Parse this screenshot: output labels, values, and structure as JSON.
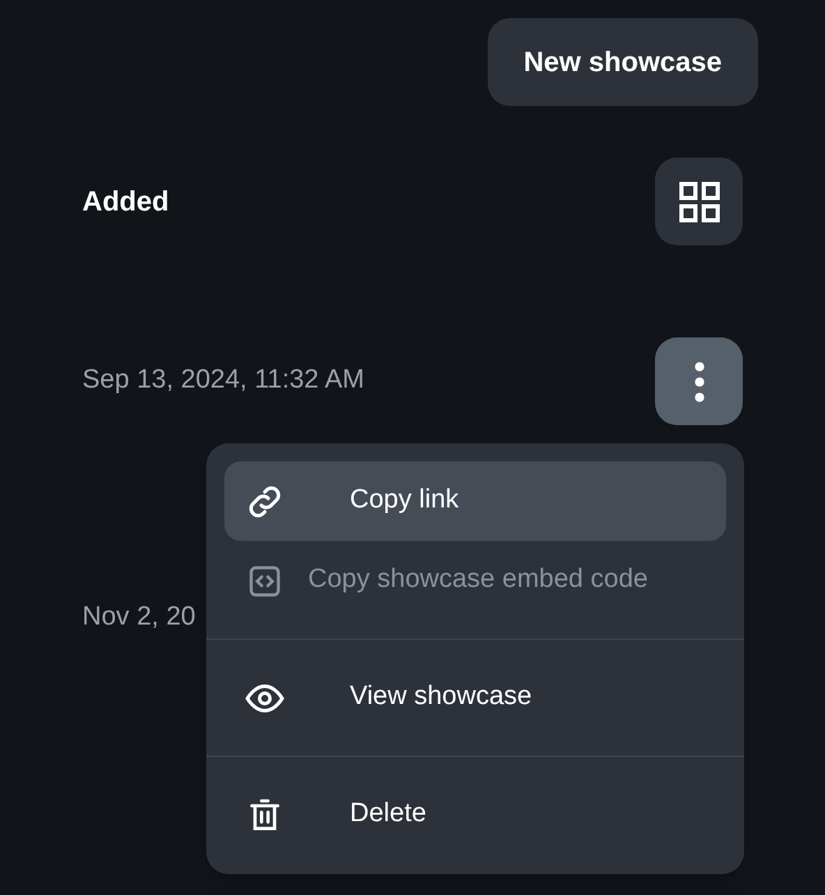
{
  "new_button": {
    "label": "New showcase"
  },
  "header": {
    "label": "Added"
  },
  "rows": [
    {
      "date": "Sep 13, 2024, 11:32 AM",
      "more_button": {
        "active": true
      }
    },
    {
      "date": "Nov 2, 20"
    }
  ],
  "menu": {
    "items": [
      {
        "kind": "link",
        "label": "Copy link",
        "selected": true,
        "disabled": false
      },
      {
        "kind": "embed",
        "label": "Copy showcase embed code",
        "selected": false,
        "disabled": true
      },
      {
        "kind": "view",
        "label": "View showcase",
        "selected": false,
        "disabled": false
      },
      {
        "kind": "delete",
        "label": "Delete",
        "selected": false,
        "disabled": false
      }
    ]
  }
}
